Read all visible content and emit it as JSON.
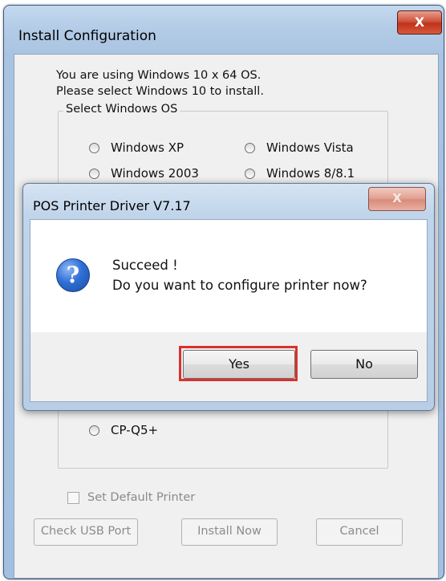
{
  "main_window": {
    "title": "Install Configuration",
    "close_glyph": "X",
    "intro_line1": "You are using Windows 10 x 64 OS.",
    "intro_line2": "Please select Windows 10 to install.",
    "os_group_label": "Select Windows OS",
    "os_options": [
      "Windows XP",
      "Windows Vista",
      "Windows 2003",
      "Windows 8/8.1"
    ],
    "printer_option": "CP-Q5+",
    "set_default_label": "Set Default Printer",
    "buttons": {
      "check_usb": "Check USB Port",
      "install_now": "Install Now",
      "cancel": "Cancel"
    }
  },
  "dialog": {
    "title": "POS Printer Driver V7.17",
    "close_glyph": "X",
    "icon": "question-icon",
    "message_line1": "Succeed !",
    "message_line2": "Do you want to configure printer now?",
    "yes_label": "Yes",
    "no_label": "No",
    "highlight_color": "#d9312d"
  }
}
